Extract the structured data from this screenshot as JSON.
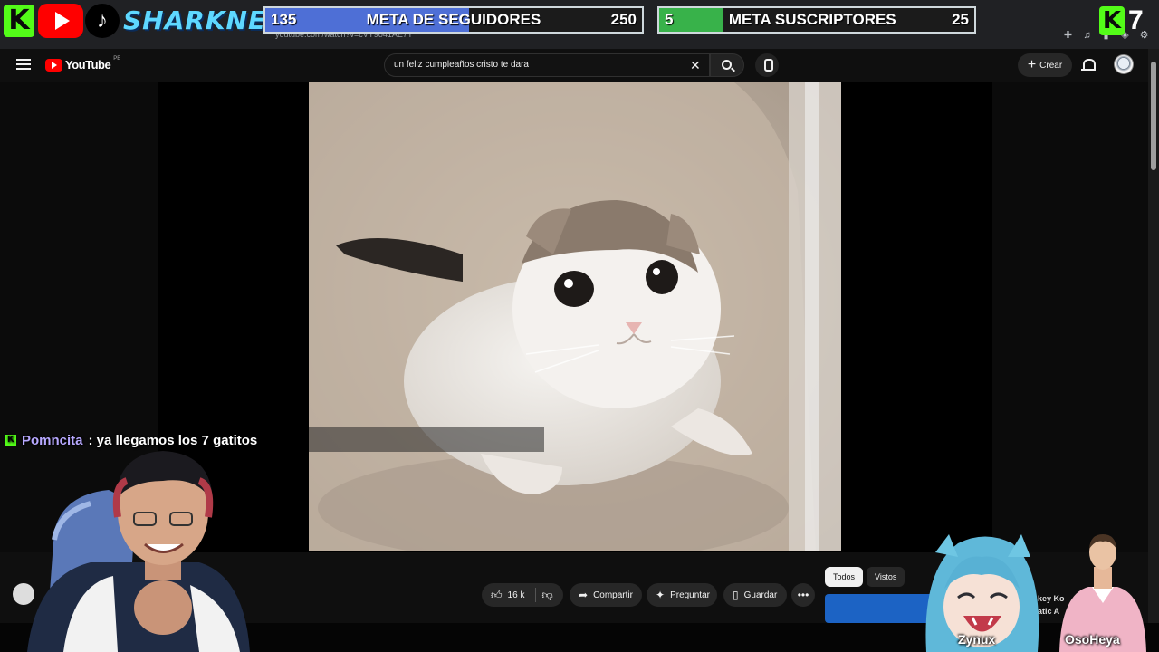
{
  "overlay": {
    "brand": "SHARKNEKU",
    "goals": [
      {
        "current": "135",
        "title": "META DE SEGUIDORES",
        "target": "250",
        "progress": 0.54,
        "color": "#4e6fd6"
      },
      {
        "current": "5",
        "title": "META SUSCRIPTORES",
        "target": "25",
        "progress": 0.2,
        "color": "#38b24a"
      }
    ],
    "viewer_count": "7"
  },
  "browser": {
    "url": "youtube.com/watch?v=cVY9o41AE7Y"
  },
  "header": {
    "logo_text": "YouTube",
    "country": "PE",
    "search_value": "un feliz cumpleaños cristo te dara",
    "create_label": "Crear"
  },
  "chat": {
    "user": "Pomncita",
    "message": ": ya llegamos los 7 gatitos"
  },
  "actions": {
    "likes": "16 k",
    "share": "Compartir",
    "ask": "Preguntar",
    "save": "Guardar"
  },
  "chips": [
    "Todos",
    "Vistos"
  ],
  "sidebar_text": [
    "key Ko",
    "atic A"
  ],
  "cams": {
    "avatar_name": "Zynux",
    "guest_name": "OsoHeya"
  },
  "colors": {
    "kick_green": "#53fc18",
    "yt_red": "#ff0000",
    "brand_cyan": "#5ed8ff"
  }
}
